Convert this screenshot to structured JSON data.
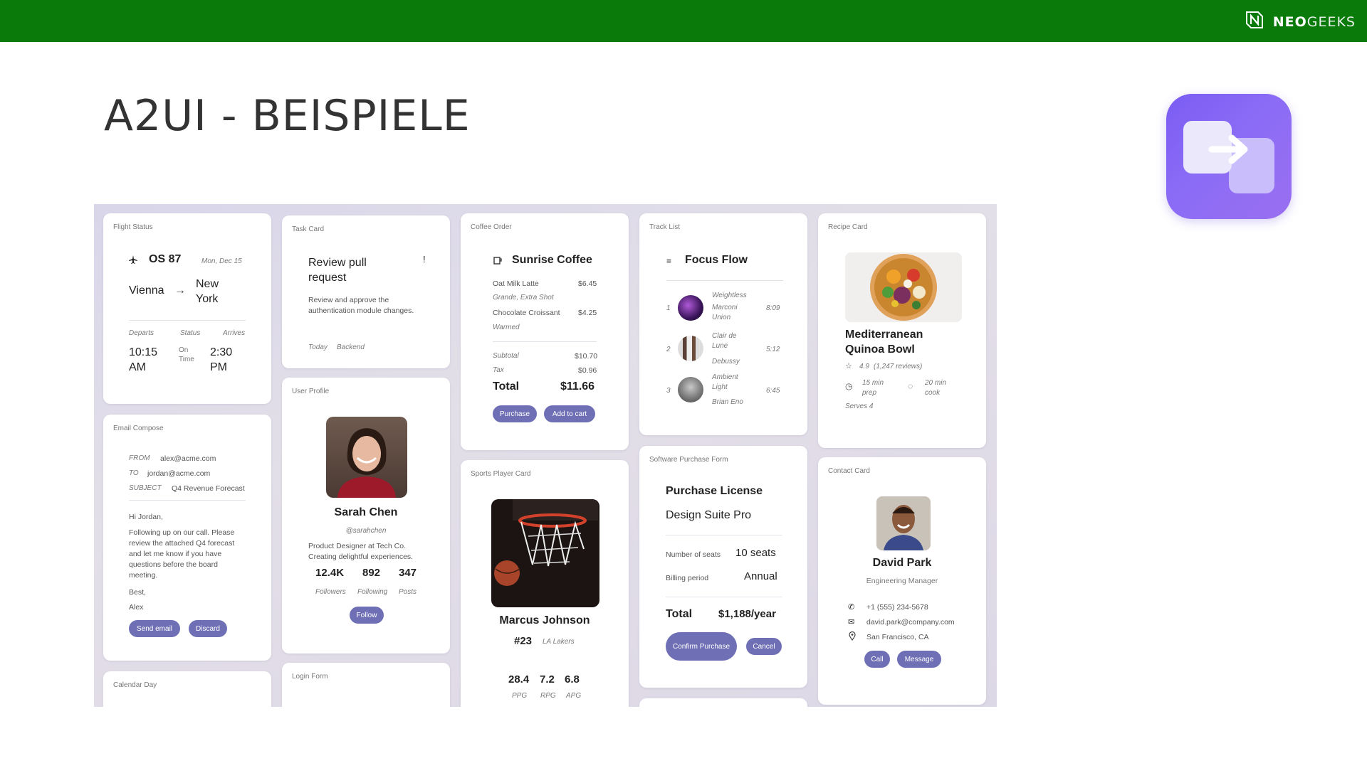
{
  "header": {
    "brand_part1": "NEO",
    "brand_part2": "GEEKS",
    "logo_icon": "neogeeks-logo-icon",
    "bg_color": "#0a7a0a"
  },
  "slide": {
    "title": "A2UI - BEISPIELE",
    "app_icon": "a2ui-app-icon"
  },
  "flight": {
    "card_title": "Flight Status",
    "flight_no": "OS 87",
    "date": "Mon, Dec 15",
    "from": "Vienna",
    "to": "New York",
    "departs_label": "Departs",
    "status_label": "Status",
    "arrives_label": "Arrives",
    "departs": "10:15 AM",
    "status": "On Time",
    "arrives": "2:30 PM"
  },
  "task": {
    "card_title": "Task Card",
    "title": "Review pull request",
    "mark": "!",
    "desc": "Review and approve the authentication module changes.",
    "tag1": "Today",
    "tag2": "Backend"
  },
  "coffee": {
    "card_title": "Coffee Order",
    "shop": "Sunrise Coffee",
    "items": [
      {
        "name": "Oat Milk Latte",
        "price": "$6.45",
        "note": "Grande, Extra Shot"
      },
      {
        "name": "Chocolate Croissant",
        "price": "$4.25",
        "note": "Warmed"
      }
    ],
    "subtotal_label": "Subtotal",
    "subtotal": "$10.70",
    "tax_label": "Tax",
    "tax": "$0.96",
    "total_label": "Total",
    "total": "$11.66",
    "purchase_btn": "Purchase",
    "cart_btn": "Add to cart"
  },
  "tracks": {
    "card_title": "Track List",
    "title": "Focus Flow",
    "items": [
      {
        "num": "1",
        "title": "Weightless",
        "artist": "Marconi Union",
        "time": "8:09"
      },
      {
        "num": "2",
        "title": "Clair de Lune",
        "artist": "Debussy",
        "time": "5:12"
      },
      {
        "num": "3",
        "title": "Ambient Light",
        "artist": "Brian Eno",
        "time": "6:45"
      }
    ]
  },
  "recipe": {
    "card_title": "Recipe Card",
    "title": "Mediterranean Quinoa Bowl",
    "rating": "4.9",
    "reviews": "(1,247 reviews)",
    "prep": "15 min prep",
    "cook": "20 min cook",
    "serves": "Serves 4"
  },
  "email": {
    "card_title": "Email Compose",
    "from_label": "FROM",
    "from": "alex@acme.com",
    "to_label": "TO",
    "to": "jordan@acme.com",
    "subject_label": "SUBJECT",
    "subject": "Q4 Revenue Forecast",
    "greeting": "Hi Jordan,",
    "body": "Following up on our call. Please review the attached Q4 forecast and let me know if you have questions before the board meeting.",
    "closing": "Best,",
    "signature": "Alex",
    "send_btn": "Send email",
    "discard_btn": "Discard"
  },
  "profile": {
    "card_title": "User Profile",
    "name": "Sarah Chen",
    "handle": "@sarahchen",
    "bio": "Product Designer at Tech Co. Creating delightful experiences.",
    "followers": "12.4K",
    "following": "892",
    "posts": "347",
    "followers_label": "Followers",
    "following_label": "Following",
    "posts_label": "Posts",
    "follow_btn": "Follow"
  },
  "player": {
    "card_title": "Sports Player Card",
    "name": "Marcus Johnson",
    "number": "#23",
    "team": "LA Lakers",
    "stat1": "28.4",
    "stat2": "7.2",
    "stat3": "6.8",
    "stat1_label": "PPG",
    "stat2_label": "RPG",
    "stat3_label": "APG"
  },
  "purchase": {
    "card_title": "Software Purchase Form",
    "title": "Purchase License",
    "product": "Design Suite Pro",
    "seats_label": "Number of seats",
    "seats": "10 seats",
    "billing_label": "Billing period",
    "billing": "Annual",
    "total_label": "Total",
    "total": "$1,188/year",
    "confirm_btn": "Confirm Purchase",
    "cancel_btn": "Cancel"
  },
  "contact": {
    "card_title": "Contact Card",
    "name": "David Park",
    "role": "Engineering Manager",
    "phone": "+1 (555) 234-5678",
    "email": "david.park@company.com",
    "location": "San Francisco, CA",
    "call_btn": "Call",
    "message_btn": "Message"
  },
  "calendar": {
    "card_title": "Calendar Day"
  },
  "login": {
    "card_title": "Login Form"
  }
}
